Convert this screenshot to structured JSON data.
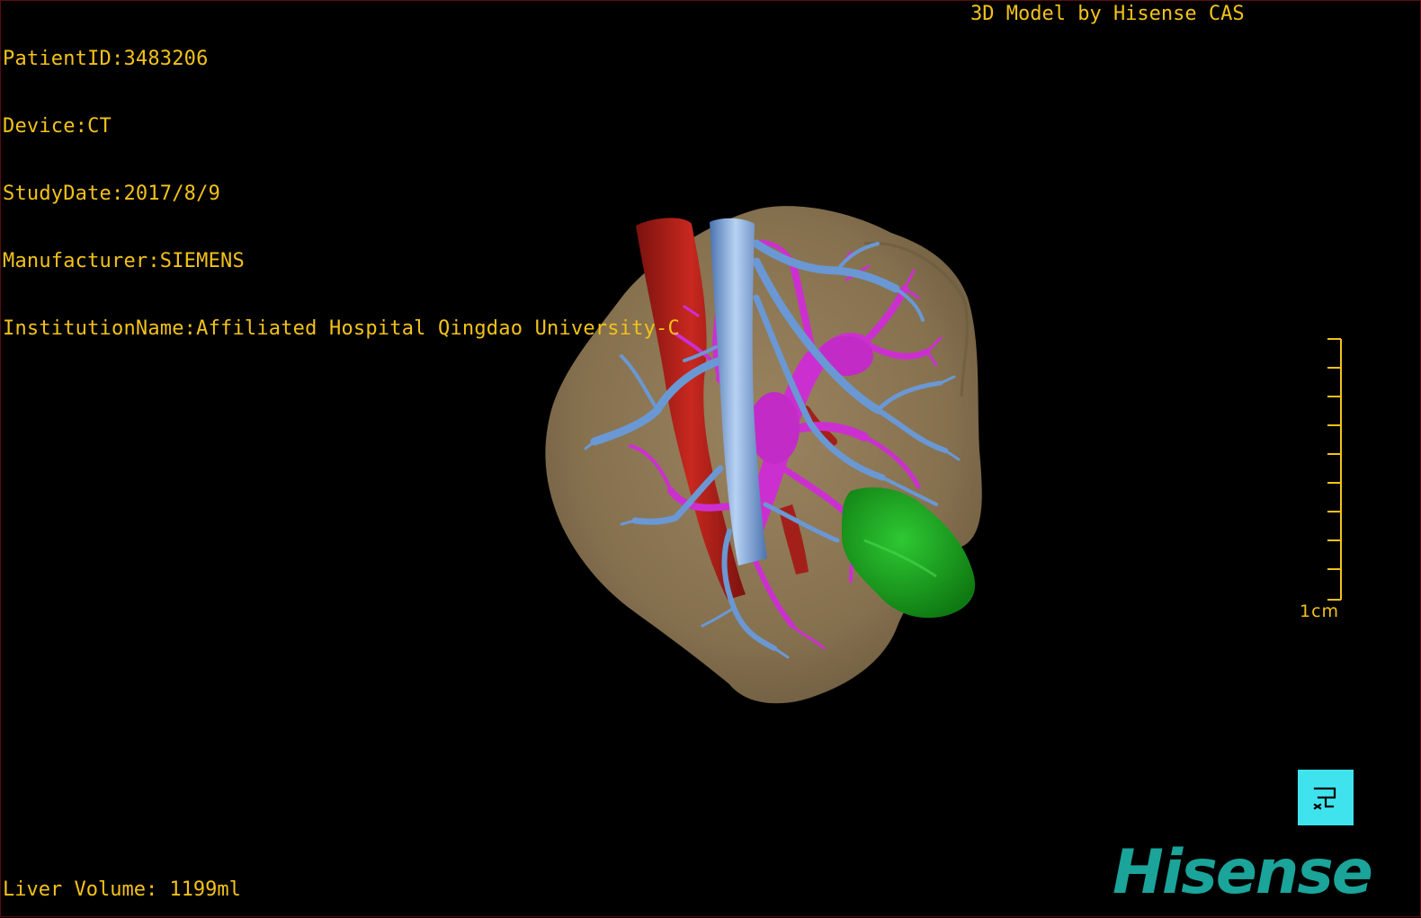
{
  "header": {
    "patient_id": "PatientID:3483206",
    "device": "Device:CT",
    "study_date": "StudyDate:2017/8/9",
    "manufacturer": "Manufacturer:SIEMENS",
    "institution": "InstitutionName:Affiliated Hospital Qingdao University-C"
  },
  "model_credit": "3D Model by Hisense CAS",
  "liver_volume": "Liver Volume: 1199ml",
  "scale": {
    "label": "1cm"
  },
  "brand": {
    "name": "Hisense",
    "color": "#1aa49a"
  },
  "controls": {
    "reset_icon": "reset-view-icon"
  },
  "colors": {
    "overlay_text": "#f3c21a",
    "liver": "#8a7555",
    "artery": "#b3231c",
    "vena_cava": "#6a98d4",
    "portal_vein": "#cc2fd0",
    "tumor": "#1aa01e",
    "reset_button_bg": "#3fe3ee"
  }
}
